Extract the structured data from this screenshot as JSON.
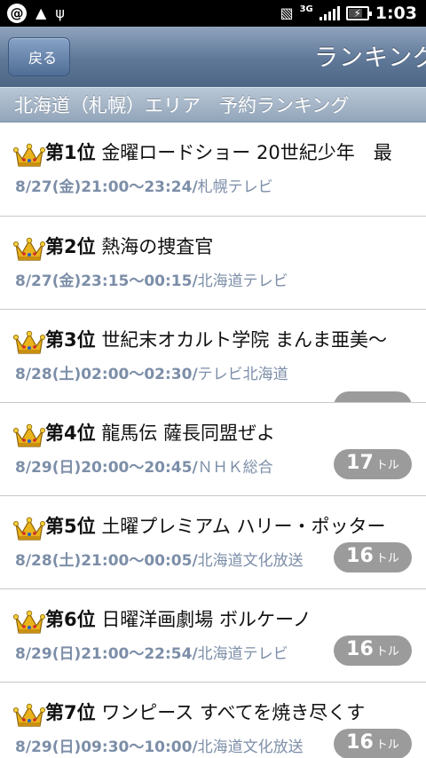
{
  "status_bar": {
    "network": "3G",
    "time": "1:03",
    "icons": [
      "at-sign-icon",
      "warning-icon",
      "usb-icon",
      "vibrate-icon",
      "signal-icon",
      "battery-charging-icon"
    ]
  },
  "header": {
    "back_label": "戻る",
    "title": "ランキング"
  },
  "section": {
    "title": "北海道（札幌）エリア　予約ランキング"
  },
  "rankings": [
    {
      "rank": "第1位",
      "title": "金曜ロードショー 20世紀少年　最",
      "date": "8/27(金)21:00～23:24/",
      "channel": "札幌テレビ",
      "count": "",
      "unit": ""
    },
    {
      "rank": "第2位",
      "title": "熱海の捜査官",
      "date": "8/27(金)23:15～00:15/",
      "channel": "北海道テレビ",
      "count": "",
      "unit": ""
    },
    {
      "rank": "第3位",
      "title": "世紀末オカルト学院 まんま亜美〜",
      "date": "8/28(土)02:00～02:30/",
      "channel": "テレビ北海道",
      "count": "",
      "unit": ""
    },
    {
      "rank": "第4位",
      "title": "龍馬伝 薩長同盟ぜよ",
      "date": "8/29(日)20:00～20:45/",
      "channel": "ＮＨＫ総合",
      "count": "17",
      "unit": "トル"
    },
    {
      "rank": "第5位",
      "title": "土曜プレミアム ハリー・ポッター",
      "date": "8/28(土)21:00～00:05/",
      "channel": "北海道文化放送",
      "count": "16",
      "unit": "トル"
    },
    {
      "rank": "第6位",
      "title": "日曜洋画劇場 ボルケーノ",
      "date": "8/29(日)21:00～22:54/",
      "channel": "北海道テレビ",
      "count": "16",
      "unit": "トル"
    },
    {
      "rank": "第7位",
      "title": "ワンピース すべてを焼き尽くす",
      "date": "8/29(日)09:30～10:00/",
      "channel": "北海道文化放送",
      "count": "16",
      "unit": "トル"
    }
  ]
}
